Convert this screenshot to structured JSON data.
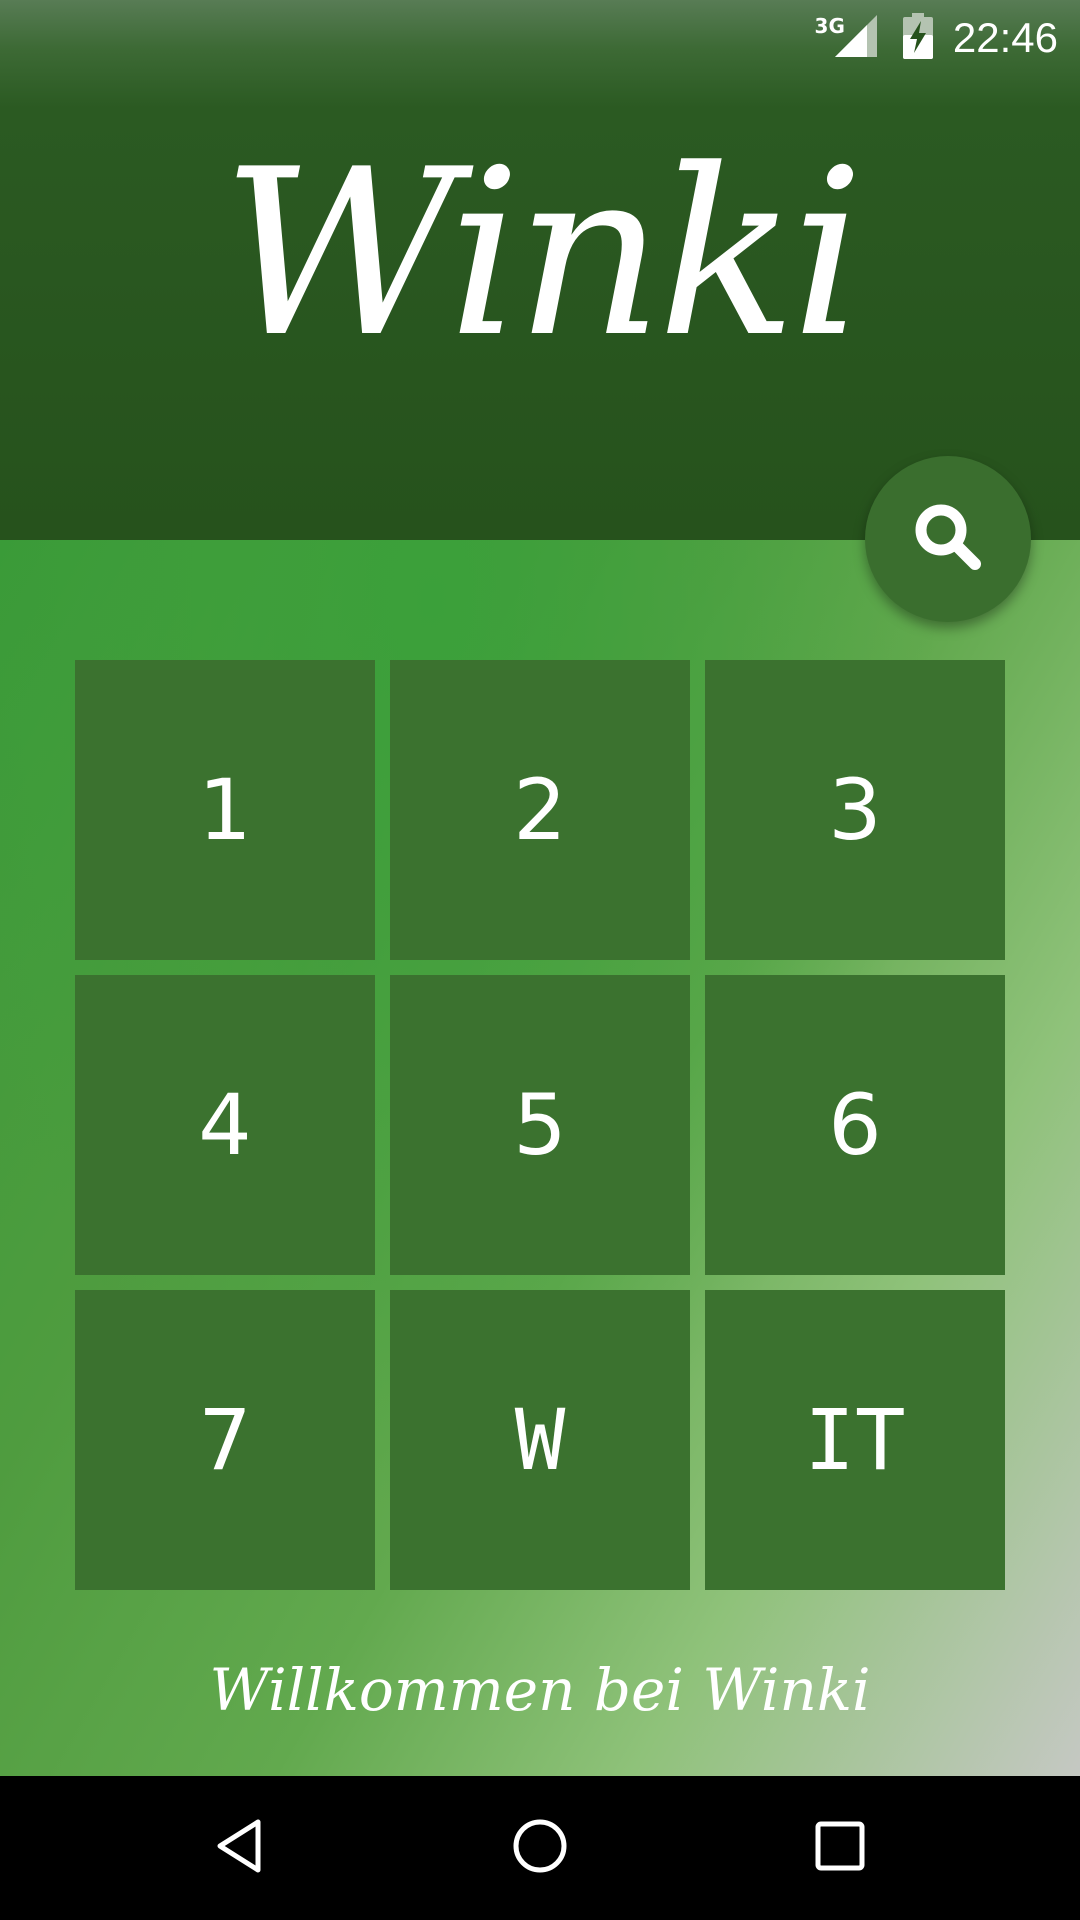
{
  "status_bar": {
    "network_type": "3G",
    "time": "22:46",
    "icons": [
      "signal-icon",
      "battery-charging-icon"
    ]
  },
  "header": {
    "app_title": "Winki",
    "search_icon": "search-icon"
  },
  "tiles": [
    {
      "label": "1"
    },
    {
      "label": "2"
    },
    {
      "label": "3"
    },
    {
      "label": "4"
    },
    {
      "label": "5"
    },
    {
      "label": "6"
    },
    {
      "label": "7"
    },
    {
      "label": "W"
    },
    {
      "label": "IT"
    }
  ],
  "footer": {
    "welcome_text": "Willkommen bei Winki"
  },
  "nav_bar": {
    "icons": [
      "back-icon",
      "home-icon",
      "recents-icon"
    ]
  },
  "colors": {
    "header_dark_green": "#26521c",
    "tile_green": "#3b722f",
    "fab_green": "#3a6e2e",
    "background_green": "#3a9a38",
    "text": "#ffffff"
  }
}
